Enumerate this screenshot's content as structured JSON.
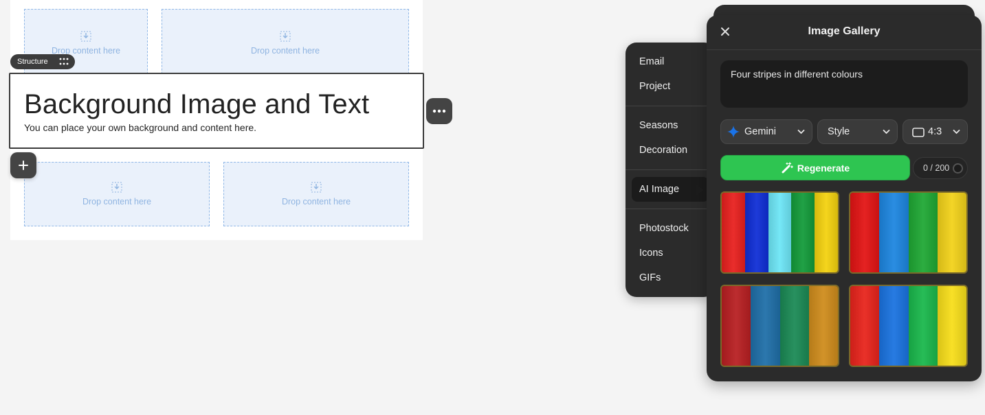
{
  "editor": {
    "drop_text": "Drop content here",
    "structure_badge": "Structure",
    "block_title": "Background Image and Text",
    "block_text": "You can place your own background and content here."
  },
  "menu": {
    "items": [
      "Email",
      "Project",
      "Seasons",
      "Decoration",
      "AI Image",
      "Photostock",
      "Icons",
      "GIFs"
    ],
    "active": "AI Image"
  },
  "gallery": {
    "title": "Image Gallery",
    "prompt": "Four stripes in different colours",
    "model": "Gemini",
    "style": "Style",
    "ratio": "4:3",
    "regenerate_label": "Regenerate",
    "counter": "0 / 200",
    "thumbnails": [
      {
        "stripes": [
          "#e8201e",
          "#0f2ed6",
          "#6de6f6",
          "#139b3a",
          "#f4d20f"
        ]
      },
      {
        "stripes": [
          "#e31414",
          "#1d86e0",
          "#1fa834",
          "#f2d21a"
        ]
      },
      {
        "stripes": [
          "#b81f22",
          "#1f6fa8",
          "#1b8a55",
          "#cf8c1c"
        ]
      },
      {
        "stripes": [
          "#e8241c",
          "#1a73e0",
          "#1ab84c",
          "#f7de1a"
        ]
      }
    ]
  },
  "colors": {
    "accent_green": "#2ec551",
    "panel_bg": "#2b2b2b",
    "drop_border": "#8eb6e6",
    "gemini_star": "#1a73e8"
  }
}
